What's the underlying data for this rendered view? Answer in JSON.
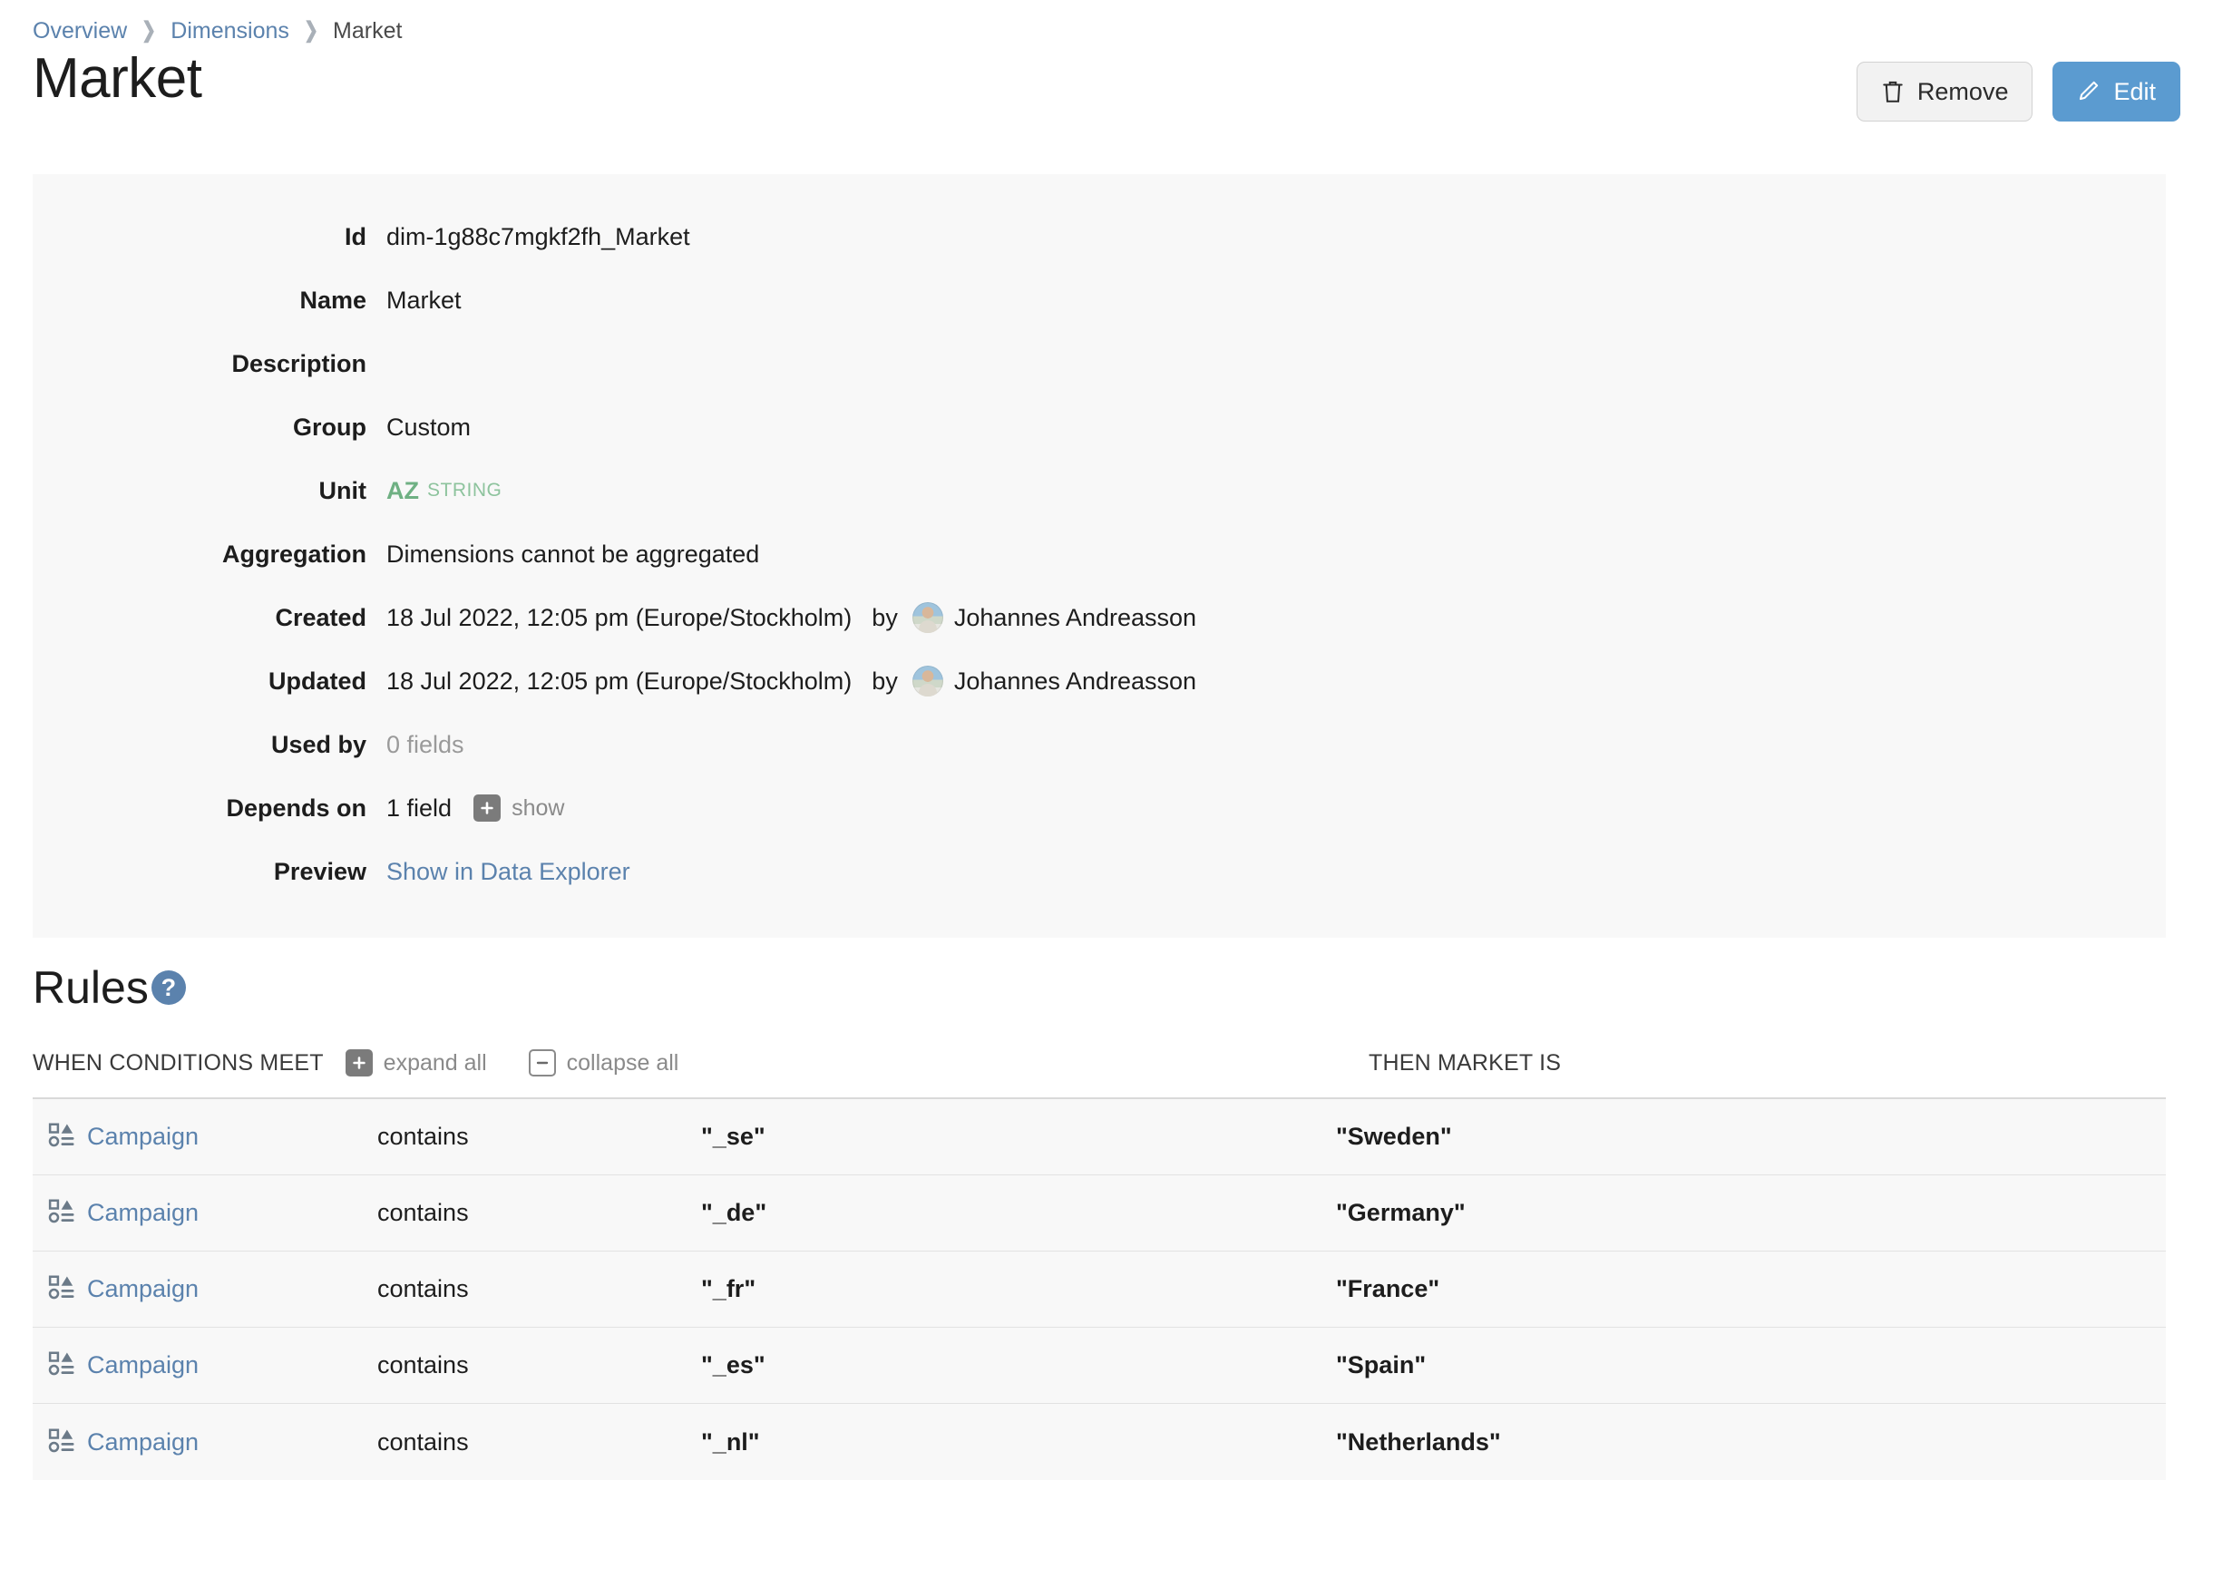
{
  "breadcrumb": {
    "items": [
      {
        "label": "Overview",
        "current": false
      },
      {
        "label": "Dimensions",
        "current": false
      },
      {
        "label": "Market",
        "current": true
      }
    ],
    "separator": "❯"
  },
  "header": {
    "title": "Market",
    "remove_label": "Remove",
    "edit_label": "Edit"
  },
  "details": {
    "id_label": "Id",
    "id_value": "dim-1g88c7mgkf2fh_Market",
    "name_label": "Name",
    "name_value": "Market",
    "description_label": "Description",
    "description_value": "",
    "group_label": "Group",
    "group_value": "Custom",
    "unit_label": "Unit",
    "unit_value": "AZ",
    "unit_type": "STRING",
    "aggregation_label": "Aggregation",
    "aggregation_value": "Dimensions cannot be aggregated",
    "created_label": "Created",
    "created_value": "18 Jul 2022, 12:05 pm (Europe/Stockholm)",
    "created_by_word": "by",
    "created_by_user": "Johannes Andreasson",
    "updated_label": "Updated",
    "updated_value": "18 Jul 2022, 12:05 pm (Europe/Stockholm)",
    "updated_by_word": "by",
    "updated_by_user": "Johannes Andreasson",
    "used_by_label": "Used by",
    "used_by_value": "0 fields",
    "depends_on_label": "Depends on",
    "depends_on_value": "1 field",
    "depends_on_show": "show",
    "preview_label": "Preview",
    "preview_link": "Show in Data Explorer"
  },
  "rules": {
    "heading": "Rules",
    "help_glyph": "?",
    "when_header": "WHEN CONDITIONS MEET",
    "then_header": "THEN MARKET IS",
    "expand_all": "expand all",
    "collapse_all": "collapse all",
    "rows": [
      {
        "field": "Campaign",
        "operator": "contains",
        "value": "\"_se\"",
        "then": "\"Sweden\""
      },
      {
        "field": "Campaign",
        "operator": "contains",
        "value": "\"_de\"",
        "then": "\"Germany\""
      },
      {
        "field": "Campaign",
        "operator": "contains",
        "value": "\"_fr\"",
        "then": "\"France\""
      },
      {
        "field": "Campaign",
        "operator": "contains",
        "value": "\"_es\"",
        "then": "\"Spain\""
      },
      {
        "field": "Campaign",
        "operator": "contains",
        "value": "\"_nl\"",
        "then": "\"Netherlands\""
      }
    ]
  },
  "colors": {
    "accent_blue": "#5b9bd0",
    "link_blue": "#5b82ad",
    "unit_green": "#6fb083",
    "panel_bg": "#f8f8f8"
  }
}
